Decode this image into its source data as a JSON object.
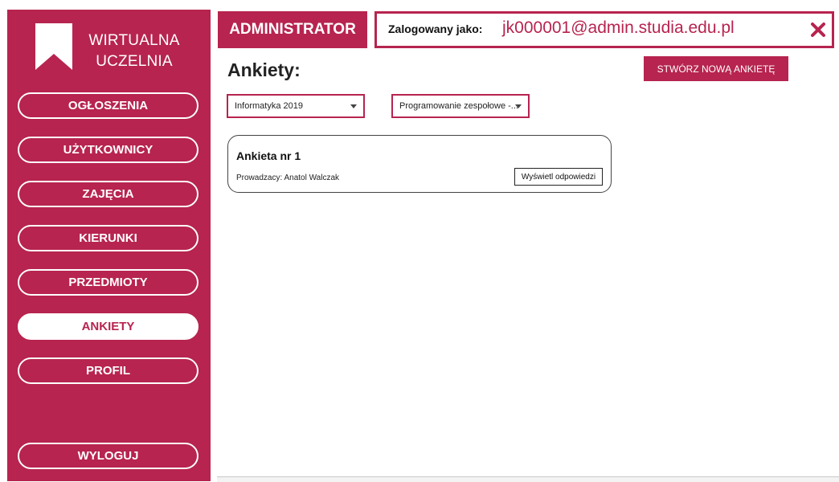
{
  "sidebar": {
    "logo_line1": "WIRTUALNA",
    "logo_line2": "UCZELNIA",
    "items": [
      {
        "label": "OGŁOSZENIA"
      },
      {
        "label": "UŻYTKOWNICY"
      },
      {
        "label": "ZAJĘCIA"
      },
      {
        "label": "KIERUNKI"
      },
      {
        "label": "PRZEDMIOTY"
      },
      {
        "label": "ANKIETY"
      },
      {
        "label": "PROFIL"
      }
    ],
    "logout_label": "WYLOGUJ"
  },
  "header": {
    "role": "ADMINISTRATOR",
    "logged_label": "Zalogowany jako:",
    "logged_email": "jk000001@admin.studia.edu.pl"
  },
  "main": {
    "title": "Ankiety:",
    "create_label": "STWÓRZ NOWĄ ANKIETĘ",
    "filter1": "Informatyka 2019",
    "filter2": "Programowanie zespołowe -...",
    "card": {
      "title": "Ankieta nr 1",
      "teacher": "Prowadzacy: Anatol Walczak",
      "button": "Wyświetl odpowiedzi"
    }
  },
  "colors": {
    "accent": "#b7244f"
  },
  "icons": {
    "logo": "bookmark-icon",
    "close": "close-icon"
  }
}
